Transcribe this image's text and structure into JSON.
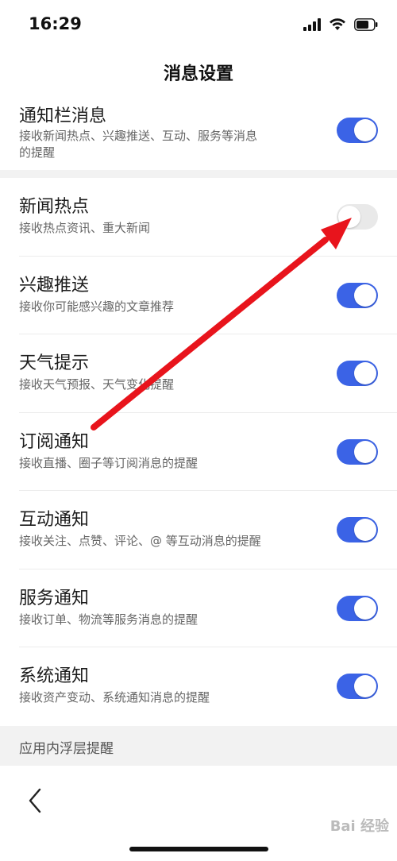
{
  "status_bar": {
    "time": "16:29"
  },
  "header": {
    "title": "消息设置"
  },
  "top_setting": {
    "title": "通知栏消息",
    "desc_line1": "接收新闻热点、兴趣推送、互动、服务等消息",
    "desc_line2": "的提醒",
    "enabled": true
  },
  "settings": [
    {
      "title": "新闻热点",
      "desc": "接收热点资讯、重大新闻",
      "enabled": false
    },
    {
      "title": "兴趣推送",
      "desc": "接收你可能感兴趣的文章推荐",
      "enabled": true
    },
    {
      "title": "天气提示",
      "desc": "接收天气预报、天气变化提醒",
      "enabled": true
    },
    {
      "title": "订阅通知",
      "desc": "接收直播、圈子等订阅消息的提醒",
      "enabled": true
    },
    {
      "title": "互动通知",
      "desc": "接收关注、点赞、评论、@ 等互动消息的提醒",
      "enabled": true
    },
    {
      "title": "服务通知",
      "desc": "接收订单、物流等服务消息的提醒",
      "enabled": true
    },
    {
      "title": "系统通知",
      "desc": "接收资产变动、系统通知消息的提醒",
      "enabled": true
    }
  ],
  "section_header": "应用内浮层提醒",
  "watermark": "Bai 经验",
  "colors": {
    "toggle_on": "#3b63e6",
    "toggle_off": "#e9e9e9",
    "annotation_arrow": "#e8141c"
  },
  "icons": [
    "signal-icon",
    "wifi-icon",
    "battery-icon",
    "back-chevron-icon"
  ]
}
